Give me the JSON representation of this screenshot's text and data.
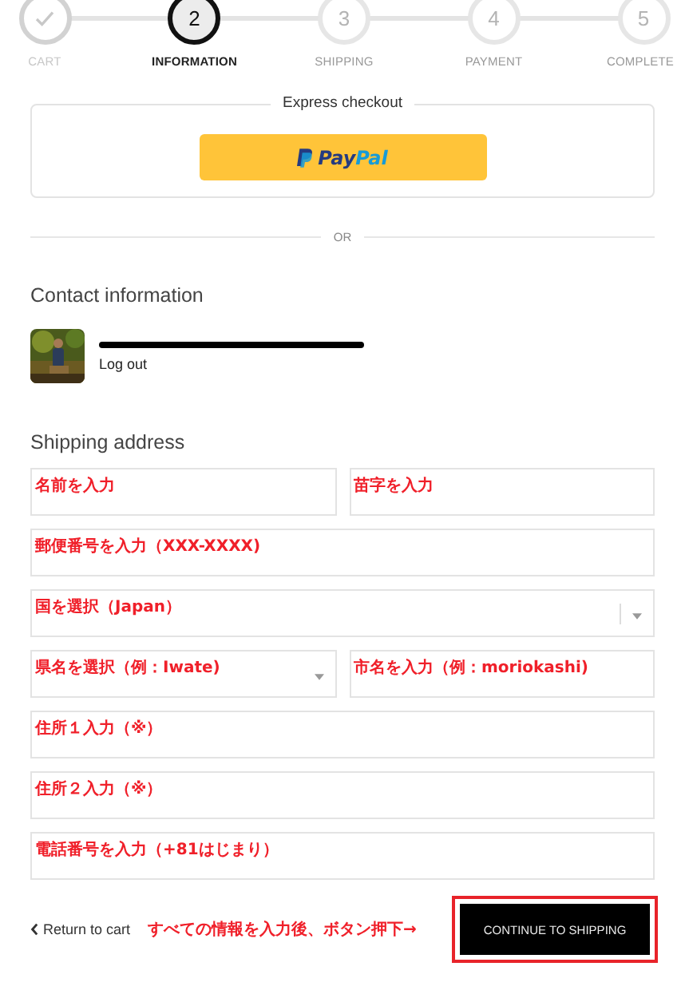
{
  "steps": [
    {
      "label": "CART",
      "completed": true,
      "selected": false
    },
    {
      "number": "2",
      "label": "INFORMATION",
      "completed": false,
      "selected": true
    },
    {
      "number": "3",
      "label": "SHIPPING",
      "completed": false,
      "selected": false
    },
    {
      "number": "4",
      "label": "PAYMENT",
      "completed": false,
      "selected": false
    },
    {
      "number": "5",
      "label": "COMPLETE",
      "completed": false,
      "selected": false
    }
  ],
  "express_checkout": {
    "title": "Express checkout",
    "paypal": {
      "part_1": "Pay",
      "part_2": "Pal"
    }
  },
  "divider_text": "OR",
  "contact": {
    "heading": "Contact information",
    "email_redacted": true,
    "logout": "Log out"
  },
  "shipping": {
    "heading": "Shipping address",
    "rows": [
      [
        {
          "kind": "input",
          "annotation": "名前を入力"
        },
        {
          "kind": "input",
          "annotation": "苗字を入力"
        }
      ],
      [
        {
          "kind": "input",
          "annotation": "郵便番号を入力（XXX-XXXX)"
        }
      ],
      [
        {
          "kind": "select",
          "annotation": "国を選択（Japan）"
        }
      ],
      [
        {
          "kind": "select",
          "annotation": "県名を選択（例：Iwate)"
        },
        {
          "kind": "input",
          "annotation": "市名を入力（例：moriokashi)"
        }
      ],
      [
        {
          "kind": "input",
          "annotation": "住所１入力（※）"
        }
      ],
      [
        {
          "kind": "input",
          "annotation": "住所２入力（※）"
        }
      ],
      [
        {
          "kind": "input",
          "annotation": "電話番号を入力（+81はじまり）"
        }
      ]
    ]
  },
  "footer": {
    "return_link": "Return to cart",
    "annotation": "すべての情報を入力後、ボタン押下→",
    "continue_button": {
      "label": "CONTINUE TO SHIPPING",
      "highlighted": true
    }
  }
}
